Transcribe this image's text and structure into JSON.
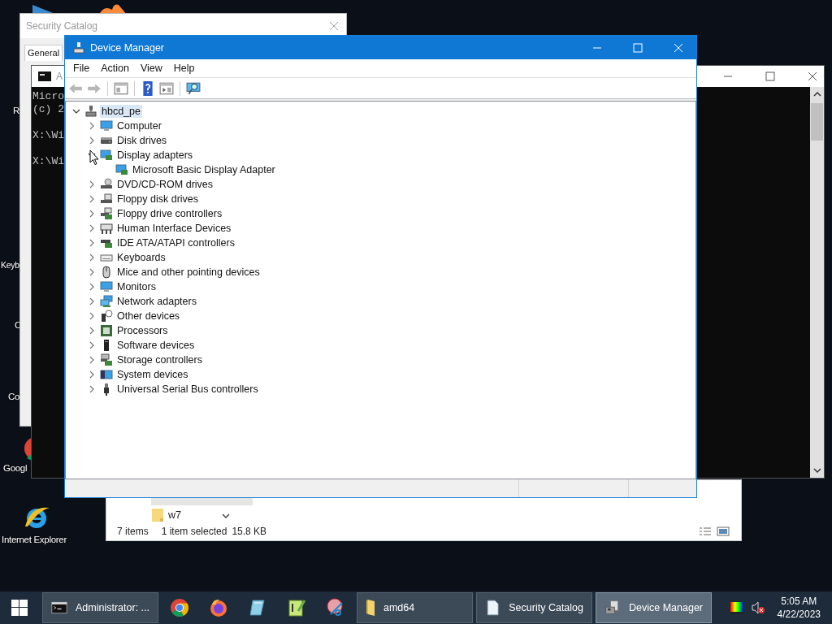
{
  "desktop_icons": [
    {
      "label": "R",
      "kind": "none"
    },
    {
      "label": "Keyb",
      "kind": "none"
    },
    {
      "label": "C",
      "kind": "none"
    },
    {
      "label": "Co",
      "kind": "none"
    },
    {
      "label": "Googl",
      "kind": "chrome"
    },
    {
      "label": "Internet Explorer",
      "kind": "ie"
    }
  ],
  "security_catalog": {
    "title": "Security Catalog",
    "tabs": [
      {
        "label": "General",
        "selected": true
      }
    ]
  },
  "console": {
    "title": "A",
    "blocks": [
      [
        "Micro",
        "(c) 2"
      ],
      [
        "X:\\Wi"
      ],
      [
        "X:\\Wi"
      ]
    ]
  },
  "explorer": {
    "items": [
      {
        "name": "w7",
        "selected": false
      }
    ],
    "status": [
      "7 items",
      "1 item selected",
      "15.8 KB"
    ]
  },
  "device_manager": {
    "title": "Device Manager",
    "menu": [
      "File",
      "Action",
      "View",
      "Help"
    ],
    "toolbar": [
      {
        "kind": "back",
        "disabled": true
      },
      {
        "kind": "forward",
        "disabled": true
      },
      {
        "kind": "sep"
      },
      {
        "kind": "console-tree",
        "disabled": false
      },
      {
        "kind": "sep"
      },
      {
        "kind": "help",
        "disabled": false
      },
      {
        "kind": "action-pane",
        "disabled": false
      },
      {
        "kind": "sep"
      },
      {
        "kind": "scan",
        "disabled": false
      }
    ],
    "tree": [
      {
        "label": "hbcd_pe",
        "kind": "root",
        "expanded": true,
        "selected": true,
        "children": [
          {
            "label": "Computer",
            "kind": "computer",
            "expanded": false,
            "selected": false
          },
          {
            "label": "Disk drives",
            "kind": "disk",
            "expanded": false,
            "selected": false
          },
          {
            "label": "Display adapters",
            "kind": "display",
            "expanded": true,
            "selected": false,
            "children": [
              {
                "label": "Microsoft Basic Display Adapter",
                "kind": "display",
                "selected": false
              }
            ]
          },
          {
            "label": "DVD/CD-ROM drives",
            "kind": "dvd",
            "expanded": false,
            "selected": false
          },
          {
            "label": "Floppy disk drives",
            "kind": "floppy",
            "expanded": false,
            "selected": false
          },
          {
            "label": "Floppy drive controllers",
            "kind": "fdc",
            "expanded": false,
            "selected": false
          },
          {
            "label": "Human Interface Devices",
            "kind": "hid",
            "expanded": false,
            "selected": false
          },
          {
            "label": "IDE ATA/ATAPI controllers",
            "kind": "ide",
            "expanded": false,
            "selected": false
          },
          {
            "label": "Keyboards",
            "kind": "keyboard",
            "expanded": false,
            "selected": false
          },
          {
            "label": "Mice and other pointing devices",
            "kind": "mouse",
            "expanded": false,
            "selected": false
          },
          {
            "label": "Monitors",
            "kind": "computer",
            "expanded": false,
            "selected": false
          },
          {
            "label": "Network adapters",
            "kind": "network",
            "expanded": false,
            "selected": false
          },
          {
            "label": "Other devices",
            "kind": "other",
            "expanded": false,
            "selected": false
          },
          {
            "label": "Processors",
            "kind": "processor",
            "expanded": false,
            "selected": false
          },
          {
            "label": "Software devices",
            "kind": "software",
            "expanded": false,
            "selected": false
          },
          {
            "label": "Storage controllers",
            "kind": "storage",
            "expanded": false,
            "selected": false
          },
          {
            "label": "System devices",
            "kind": "system",
            "expanded": false,
            "selected": false
          },
          {
            "label": "Universal Serial Bus controllers",
            "kind": "usb",
            "expanded": false,
            "selected": false
          }
        ]
      }
    ]
  },
  "taskbar": {
    "buttons": [
      {
        "kind": "console",
        "label": "Administrator: ...",
        "active": false
      },
      {
        "kind": "chrome",
        "active": false
      },
      {
        "kind": "firefox",
        "active": false
      },
      {
        "kind": "notepad",
        "active": false
      },
      {
        "kind": "notepadpp",
        "active": false
      },
      {
        "kind": "snip",
        "active": false
      },
      {
        "kind": "folder",
        "label": "amd64",
        "active": false
      },
      {
        "kind": "document",
        "label": "Security Catalog",
        "active": false
      },
      {
        "kind": "devmgr",
        "label": "Device Manager",
        "active": true
      }
    ],
    "tray": {
      "muted": true,
      "time": "5:05 AM",
      "date": "4/22/2023"
    }
  }
}
